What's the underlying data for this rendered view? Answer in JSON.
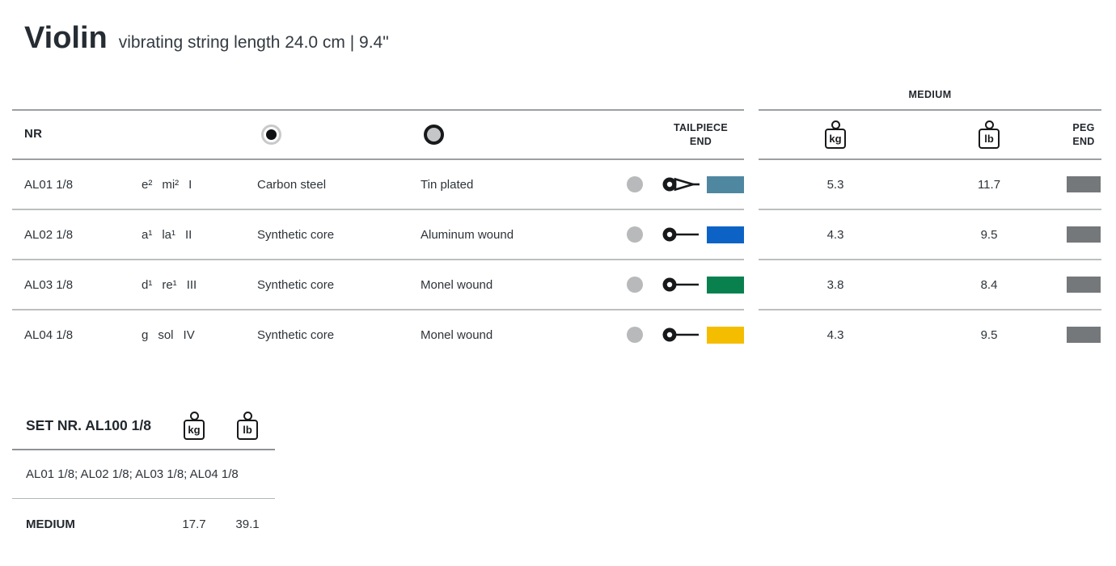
{
  "page": {
    "title": "Violin",
    "subtitle": "vibrating string length 24.0 cm | 9.4\""
  },
  "table": {
    "header": {
      "nr": "NR",
      "core_icon": "core-material",
      "winding_icon": "winding-material",
      "tailpiece_line1": "TAILPIECE",
      "tailpiece_line2": "END",
      "tension_group": "MEDIUM",
      "kg_unit": "kg",
      "lb_unit": "lb",
      "peg_line1": "PEG",
      "peg_line2": "END"
    },
    "rows": [
      {
        "nr": "AL01 1/8",
        "pitch": "e²",
        "solfege": "mi²",
        "position": "I",
        "core": "Carbon steel",
        "winding": "Tin plated",
        "tailpiece_end_type": "loop-end",
        "tail_color": "#4f87a1",
        "kg": "5.3",
        "lb": "11.7",
        "peg_color": "#75787b"
      },
      {
        "nr": "AL02 1/8",
        "pitch": "a¹",
        "solfege": "la¹",
        "position": "II",
        "core": "Synthetic core",
        "winding": "Aluminum wound",
        "tailpiece_end_type": "ball-end",
        "tail_color": "#0d63c5",
        "kg": "4.3",
        "lb": "9.5",
        "peg_color": "#75787b"
      },
      {
        "nr": "AL03 1/8",
        "pitch": "d¹",
        "solfege": "re¹",
        "position": "III",
        "core": "Synthetic core",
        "winding": "Monel wound",
        "tailpiece_end_type": "ball-end",
        "tail_color": "#08814f",
        "kg": "3.8",
        "lb": "8.4",
        "peg_color": "#75787b"
      },
      {
        "nr": "AL04 1/8",
        "pitch": "g",
        "solfege": "sol",
        "position": "IV",
        "core": "Synthetic core",
        "winding": "Monel wound",
        "tailpiece_end_type": "ball-end",
        "tail_color": "#f5bd00",
        "kg": "4.3",
        "lb": "9.5",
        "peg_color": "#75787b"
      }
    ]
  },
  "set": {
    "title": "SET NR. AL100 1/8",
    "kg_unit": "kg",
    "lb_unit": "lb",
    "contents": "AL01 1/8; AL02 1/8; AL03 1/8; AL04 1/8",
    "gauge_label": "MEDIUM",
    "kg": "17.7",
    "lb": "39.1"
  }
}
